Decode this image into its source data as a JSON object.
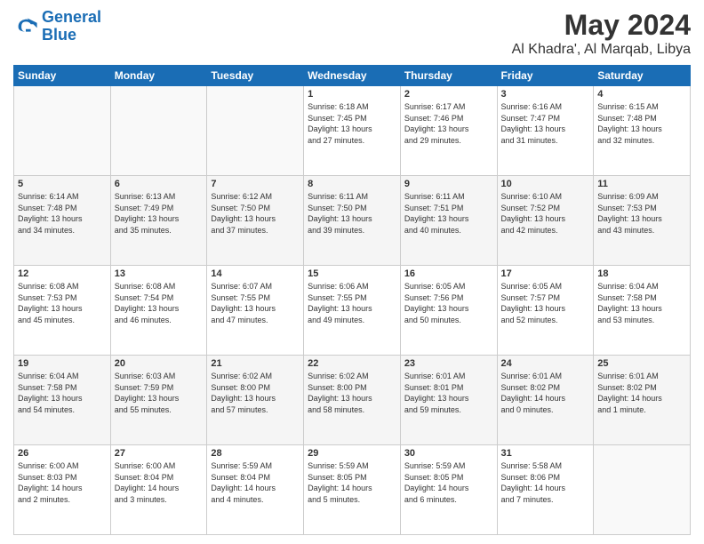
{
  "logo": {
    "line1": "General",
    "line2": "Blue"
  },
  "title": "May 2024",
  "subtitle": "Al Khadra', Al Marqab, Libya",
  "days_header": [
    "Sunday",
    "Monday",
    "Tuesday",
    "Wednesday",
    "Thursday",
    "Friday",
    "Saturday"
  ],
  "weeks": [
    [
      {
        "day": "",
        "info": ""
      },
      {
        "day": "",
        "info": ""
      },
      {
        "day": "",
        "info": ""
      },
      {
        "day": "1",
        "info": "Sunrise: 6:18 AM\nSunset: 7:45 PM\nDaylight: 13 hours\nand 27 minutes."
      },
      {
        "day": "2",
        "info": "Sunrise: 6:17 AM\nSunset: 7:46 PM\nDaylight: 13 hours\nand 29 minutes."
      },
      {
        "day": "3",
        "info": "Sunrise: 6:16 AM\nSunset: 7:47 PM\nDaylight: 13 hours\nand 31 minutes."
      },
      {
        "day": "4",
        "info": "Sunrise: 6:15 AM\nSunset: 7:48 PM\nDaylight: 13 hours\nand 32 minutes."
      }
    ],
    [
      {
        "day": "5",
        "info": "Sunrise: 6:14 AM\nSunset: 7:48 PM\nDaylight: 13 hours\nand 34 minutes."
      },
      {
        "day": "6",
        "info": "Sunrise: 6:13 AM\nSunset: 7:49 PM\nDaylight: 13 hours\nand 35 minutes."
      },
      {
        "day": "7",
        "info": "Sunrise: 6:12 AM\nSunset: 7:50 PM\nDaylight: 13 hours\nand 37 minutes."
      },
      {
        "day": "8",
        "info": "Sunrise: 6:11 AM\nSunset: 7:50 PM\nDaylight: 13 hours\nand 39 minutes."
      },
      {
        "day": "9",
        "info": "Sunrise: 6:11 AM\nSunset: 7:51 PM\nDaylight: 13 hours\nand 40 minutes."
      },
      {
        "day": "10",
        "info": "Sunrise: 6:10 AM\nSunset: 7:52 PM\nDaylight: 13 hours\nand 42 minutes."
      },
      {
        "day": "11",
        "info": "Sunrise: 6:09 AM\nSunset: 7:53 PM\nDaylight: 13 hours\nand 43 minutes."
      }
    ],
    [
      {
        "day": "12",
        "info": "Sunrise: 6:08 AM\nSunset: 7:53 PM\nDaylight: 13 hours\nand 45 minutes."
      },
      {
        "day": "13",
        "info": "Sunrise: 6:08 AM\nSunset: 7:54 PM\nDaylight: 13 hours\nand 46 minutes."
      },
      {
        "day": "14",
        "info": "Sunrise: 6:07 AM\nSunset: 7:55 PM\nDaylight: 13 hours\nand 47 minutes."
      },
      {
        "day": "15",
        "info": "Sunrise: 6:06 AM\nSunset: 7:55 PM\nDaylight: 13 hours\nand 49 minutes."
      },
      {
        "day": "16",
        "info": "Sunrise: 6:05 AM\nSunset: 7:56 PM\nDaylight: 13 hours\nand 50 minutes."
      },
      {
        "day": "17",
        "info": "Sunrise: 6:05 AM\nSunset: 7:57 PM\nDaylight: 13 hours\nand 52 minutes."
      },
      {
        "day": "18",
        "info": "Sunrise: 6:04 AM\nSunset: 7:58 PM\nDaylight: 13 hours\nand 53 minutes."
      }
    ],
    [
      {
        "day": "19",
        "info": "Sunrise: 6:04 AM\nSunset: 7:58 PM\nDaylight: 13 hours\nand 54 minutes."
      },
      {
        "day": "20",
        "info": "Sunrise: 6:03 AM\nSunset: 7:59 PM\nDaylight: 13 hours\nand 55 minutes."
      },
      {
        "day": "21",
        "info": "Sunrise: 6:02 AM\nSunset: 8:00 PM\nDaylight: 13 hours\nand 57 minutes."
      },
      {
        "day": "22",
        "info": "Sunrise: 6:02 AM\nSunset: 8:00 PM\nDaylight: 13 hours\nand 58 minutes."
      },
      {
        "day": "23",
        "info": "Sunrise: 6:01 AM\nSunset: 8:01 PM\nDaylight: 13 hours\nand 59 minutes."
      },
      {
        "day": "24",
        "info": "Sunrise: 6:01 AM\nSunset: 8:02 PM\nDaylight: 14 hours\nand 0 minutes."
      },
      {
        "day": "25",
        "info": "Sunrise: 6:01 AM\nSunset: 8:02 PM\nDaylight: 14 hours\nand 1 minute."
      }
    ],
    [
      {
        "day": "26",
        "info": "Sunrise: 6:00 AM\nSunset: 8:03 PM\nDaylight: 14 hours\nand 2 minutes."
      },
      {
        "day": "27",
        "info": "Sunrise: 6:00 AM\nSunset: 8:04 PM\nDaylight: 14 hours\nand 3 minutes."
      },
      {
        "day": "28",
        "info": "Sunrise: 5:59 AM\nSunset: 8:04 PM\nDaylight: 14 hours\nand 4 minutes."
      },
      {
        "day": "29",
        "info": "Sunrise: 5:59 AM\nSunset: 8:05 PM\nDaylight: 14 hours\nand 5 minutes."
      },
      {
        "day": "30",
        "info": "Sunrise: 5:59 AM\nSunset: 8:05 PM\nDaylight: 14 hours\nand 6 minutes."
      },
      {
        "day": "31",
        "info": "Sunrise: 5:58 AM\nSunset: 8:06 PM\nDaylight: 14 hours\nand 7 minutes."
      },
      {
        "day": "",
        "info": ""
      }
    ]
  ]
}
